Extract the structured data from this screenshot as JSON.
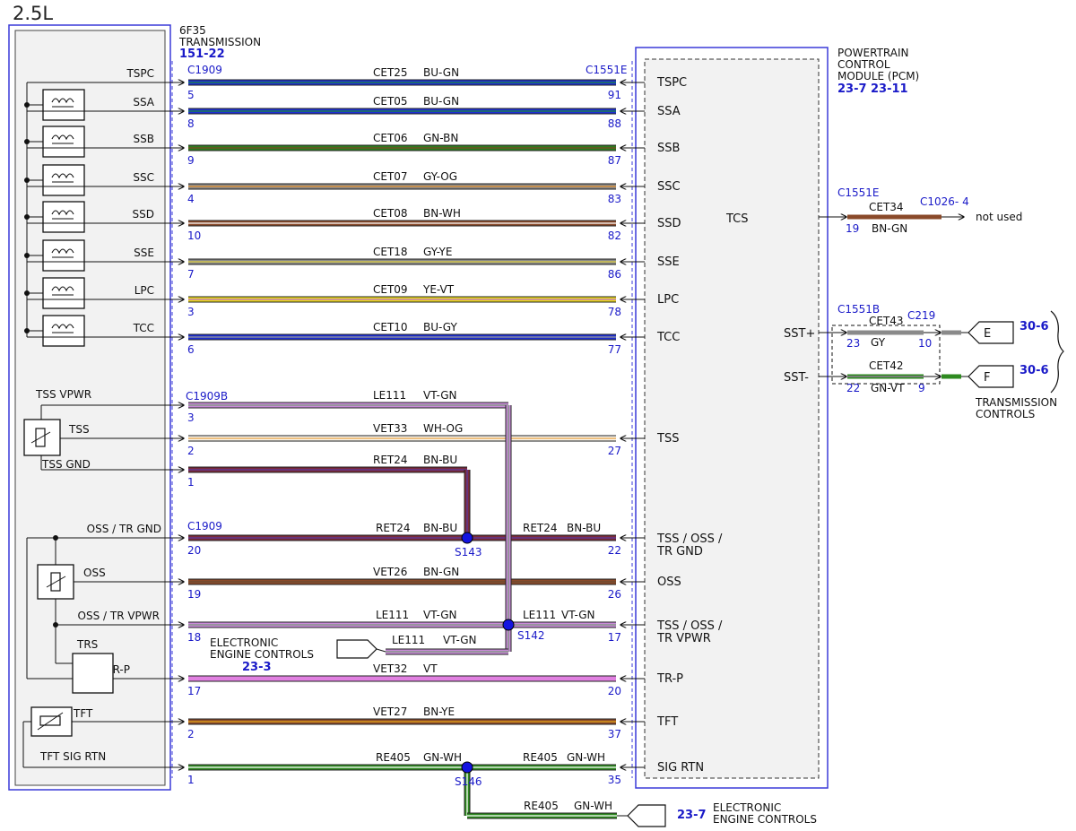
{
  "header": {
    "engine": "2.5L"
  },
  "transmission": {
    "name_line1": "6F35",
    "name_line2": "TRANSMISSION",
    "ref": "151-22"
  },
  "pcm": {
    "line1": "POWERTRAIN",
    "line2": "CONTROL",
    "line3": "MODULE (PCM)",
    "ref1": "23-7",
    "ref2": "23-11",
    "tcs": "TCS"
  },
  "connectors": {
    "c1909": "C1909",
    "c1909b": "C1909B",
    "c1551e": "C1551E",
    "c1551b": "C1551B",
    "c219": "C219",
    "c1026": "C1026- 4"
  },
  "colors": {
    "box_blue": "#3a3ad8",
    "ref_blue": "#1a1ac8",
    "text": "#111111"
  },
  "wires": [
    {
      "id": "tspc",
      "left_label": "TSPC",
      "circuit": "CET25",
      "color": "BU-GN",
      "pin_l": "5",
      "pin_r": "91",
      "right_label": "TSPC",
      "c1": "#1e2fd0",
      "c2": "#1c8a3a"
    },
    {
      "id": "ssa",
      "left_label": "SSA",
      "circuit": "CET05",
      "color": "BU-GN",
      "pin_l": "8",
      "pin_r": "88",
      "right_label": "SSA",
      "c1": "#1e2fd0",
      "c2": "#1c8a3a"
    },
    {
      "id": "ssb",
      "left_label": "SSB",
      "circuit": "CET06",
      "color": "GN-BN",
      "pin_l": "9",
      "pin_r": "87",
      "right_label": "SSB",
      "c1": "#2e7d20",
      "c2": "#7a4a22"
    },
    {
      "id": "ssc",
      "left_label": "SSC",
      "circuit": "CET07",
      "color": "GY-OG",
      "pin_l": "4",
      "pin_r": "83",
      "right_label": "SSC",
      "c1": "#8a8a8a",
      "c2": "#e8902a"
    },
    {
      "id": "ssd",
      "left_label": "SSD",
      "circuit": "CET08",
      "color": "BN-WH",
      "pin_l": "10",
      "pin_r": "82",
      "right_label": "SSD",
      "c1": "#8a4a2a",
      "c2": "#ffffff"
    },
    {
      "id": "sse",
      "left_label": "SSE",
      "circuit": "CET18",
      "color": "GY-YE",
      "pin_l": "7",
      "pin_r": "86",
      "right_label": "SSE",
      "c1": "#8a8a8a",
      "c2": "#e0d040"
    },
    {
      "id": "lpc",
      "left_label": "LPC",
      "circuit": "CET09",
      "color": "YE-VT",
      "pin_l": "3",
      "pin_r": "78",
      "right_label": "LPC",
      "c1": "#e8d818",
      "c2": "#c070d0"
    },
    {
      "id": "tcc",
      "left_label": "TCC",
      "circuit": "CET10",
      "color": "BU-GY",
      "pin_l": "6",
      "pin_r": "77",
      "right_label": "TCC",
      "c1": "#1e2fd0",
      "c2": "#9a9a9a"
    },
    {
      "id": "tssvpwr",
      "left_label": "TSS VPWR",
      "circuit": "LE111",
      "color": "VT-GN",
      "pin_l": "3",
      "pin_r": "",
      "right_label": "",
      "c1": "#c88ad8",
      "c2": "#7a9a7a"
    },
    {
      "id": "tss",
      "left_label": "TSS",
      "circuit": "VET33",
      "color": "WH-OG",
      "pin_l": "2",
      "pin_r": "27",
      "right_label": "TSS",
      "c1": "#f8f4ec",
      "c2": "#e8a040"
    },
    {
      "id": "tssgnd",
      "left_label": "TSS GND",
      "circuit": "RET24",
      "color": "BN-BU",
      "pin_l": "1",
      "pin_r": "",
      "right_label": "",
      "c1": "#7a2a3a",
      "c2": "#5a3aa0"
    },
    {
      "id": "oss_gnd",
      "left_label": "OSS / TR GND",
      "circuit": "RET24",
      "color": "BN-BU",
      "pin_l": "20",
      "pin_r": "22",
      "right_label": "TSS / OSS /",
      "right_label2": "TR GND",
      "circuit_r": "RET24",
      "color_r": "BN-BU",
      "splice": "S143",
      "c1": "#7a2a3a",
      "c2": "#5a3aa0"
    },
    {
      "id": "oss",
      "left_label": "OSS",
      "circuit": "VET26",
      "color": "BN-GN",
      "pin_l": "19",
      "pin_r": "26",
      "right_label": "OSS",
      "c1": "#8a4a2a",
      "c2": "#6a4a30"
    },
    {
      "id": "oss_vpwr",
      "left_label": "OSS / TR VPWR",
      "circuit": "LE111",
      "color": "VT-GN",
      "pin_l": "18",
      "pin_r": "17",
      "right_label": "TSS / OSS /",
      "right_label2": "TR VPWR",
      "circuit_r": "LE111",
      "color_r": "VT-GN",
      "splice": "S142",
      "c1": "#c88ad8",
      "c2": "#7a9a7a"
    },
    {
      "id": "trp",
      "left_label": "TR-P",
      "circuit": "VET32",
      "color": "VT",
      "pin_l": "17",
      "pin_r": "20",
      "right_label": "TR-P",
      "c1": "#e080e0",
      "c2": "#e080e0"
    },
    {
      "id": "tft",
      "left_label": "TFT",
      "circuit": "VET27",
      "color": "BN-YE",
      "pin_l": "2",
      "pin_r": "37",
      "right_label": "TFT",
      "c1": "#8a4a2a",
      "c2": "#e8a818"
    },
    {
      "id": "sigrtn",
      "left_label": "TFT SIG RTN",
      "circuit": "RE405",
      "color": "GN-WH",
      "pin_l": "1",
      "pin_r": "35",
      "right_label": "SIG RTN",
      "circuit_r": "RE405",
      "color_r": "GN-WH",
      "splice": "S146",
      "c1": "#2e8a20",
      "c2": "#ffffff"
    }
  ],
  "components": {
    "trs": "TRS"
  },
  "branches": {
    "le111_stub": {
      "circuit": "LE111",
      "color": "VT-GN"
    },
    "eec_left": {
      "line1": "ELECTRONIC",
      "line2": "ENGINE CONTROLS",
      "ref": "23-3"
    },
    "re405_stub": {
      "circuit": "RE405",
      "color": "GN-WH"
    },
    "eec_bottom": {
      "ref": "23-7",
      "line1": "ELECTRONIC",
      "line2": "ENGINE CONTROLS"
    }
  },
  "right_side": {
    "tcs_wire": {
      "circuit": "CET34",
      "color": "BN-GN",
      "pin": "19",
      "not_used": "not used"
    },
    "sst_plus": {
      "label": "SST+",
      "circuit": "CET43",
      "color": "GY",
      "pin_l": "23",
      "pin_r": "10",
      "conn": "E",
      "ref": "30-6"
    },
    "sst_minus": {
      "label": "SST-",
      "circuit": "CET42",
      "color": "GN-VT",
      "pin_l": "22",
      "pin_r": "9",
      "conn": "F",
      "ref": "30-6"
    },
    "trans_controls": {
      "line1": "TRANSMISSION",
      "line2": "CONTROLS"
    }
  }
}
